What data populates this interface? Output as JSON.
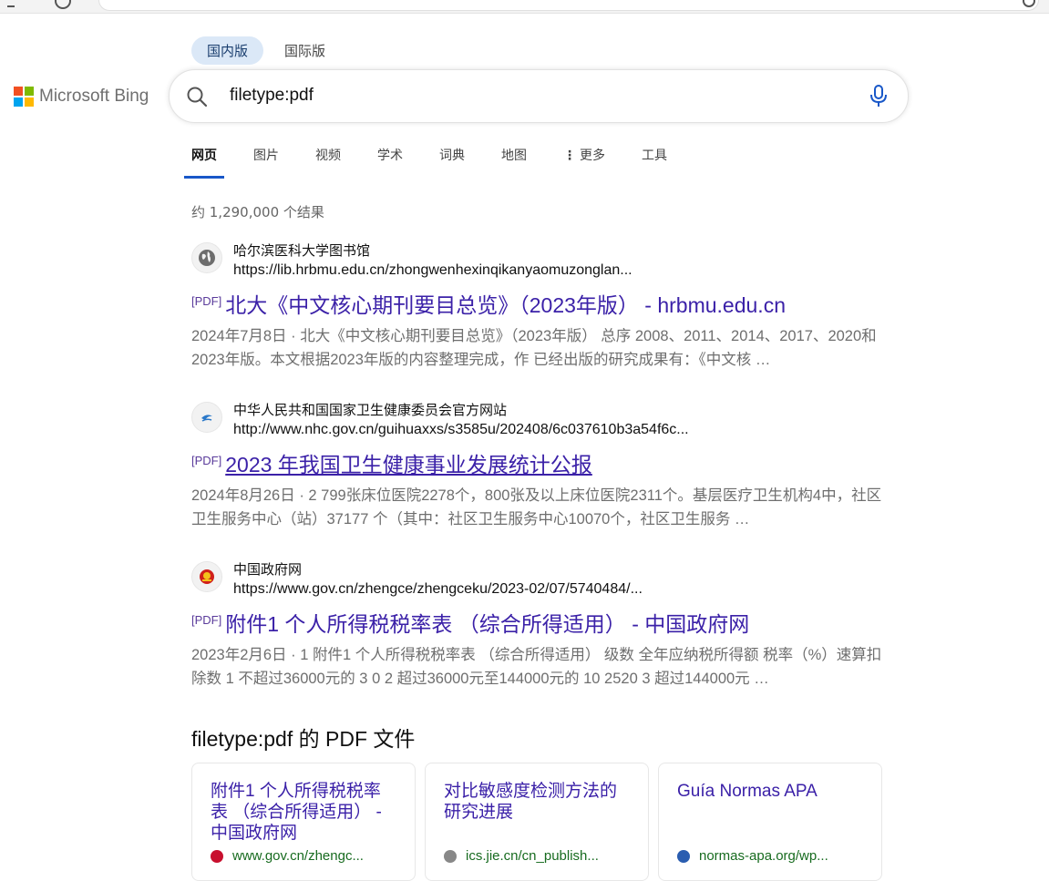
{
  "market_tabs": [
    {
      "label": "国内版"
    },
    {
      "label": "国际版"
    }
  ],
  "logo": {
    "text": "Microsoft Bing"
  },
  "search": {
    "query": "filetype:pdf"
  },
  "nav": {
    "items": [
      "网页",
      "图片",
      "视频",
      "学术",
      "词典",
      "地图",
      "更多",
      "工具"
    ]
  },
  "result_count": "约 1,290,000 个结果",
  "results": [
    {
      "source_name": "哈尔滨医科大学图书馆",
      "url": "https://lib.hrbmu.edu.cn/zhongwenhexinqikanyaomuzonglan...",
      "tag": "[PDF]",
      "title": "北大《中文核心期刊要目总览》（2023年版） - hrbmu.edu.cn",
      "date": "2024年7月8日 · ",
      "snippet": "北大《中文核心期刊要目总览》（2023年版） 总序 2008、2011、2014、2017、2020和2023年版。本文根据2023年版的内容整理完成，作 已经出版的研究成果有：《中文核 …"
    },
    {
      "source_name": "中华人民共和国国家卫生健康委员会官方网站",
      "url": "http://www.nhc.gov.cn/guihuaxxs/s3585u/202408/6c037610b3a54f6c...",
      "tag": "[PDF]",
      "title": "2023 年我国卫生健康事业发展统计公报",
      "date": "2024年8月26日 · ",
      "snippet": "2 799张床位医院2278个，800张及以上床位医院2311个。基层医疗卫生机构4中，社区卫生服务中心（站）37177 个（其中：社区卫生服务中心10070个，社区卫生服务 …"
    },
    {
      "source_name": "中国政府网",
      "url": "https://www.gov.cn/zhengce/zhengceku/2023-02/07/5740484/...",
      "tag": "[PDF]",
      "title": "附件1 个人所得税税率表 （综合所得适用） - 中国政府网",
      "date": "2023年2月6日 · ",
      "snippet": "1 附件1 个人所得税税率表 （综合所得适用） 级数 全年应纳税所得额 税率（%）速算扣除数 1 不超过36000元的 3 0 2 超过36000元至144000元的 10 2520 3 超过144000元 …"
    }
  ],
  "pdf_section": {
    "heading": "filetype:pdf 的 PDF 文件",
    "cards": [
      {
        "title": "附件1 个人所得税税率表 （综合所得适用） - 中国政府网",
        "source": "www.gov.cn/zhengc...",
        "icon_color": "#c8102e"
      },
      {
        "title": "对比敏感度检测方法的研究进展",
        "source": "ics.jie.cn/cn_publish...",
        "icon_color": "#888888"
      },
      {
        "title": "Guía Normas APA",
        "source": "normas-apa.org/wp...",
        "icon_color": "#2a5db0"
      }
    ]
  },
  "colors": {
    "accent": "#1857c8",
    "title_link": "#3b21a8",
    "url_green": "#176b1f"
  }
}
